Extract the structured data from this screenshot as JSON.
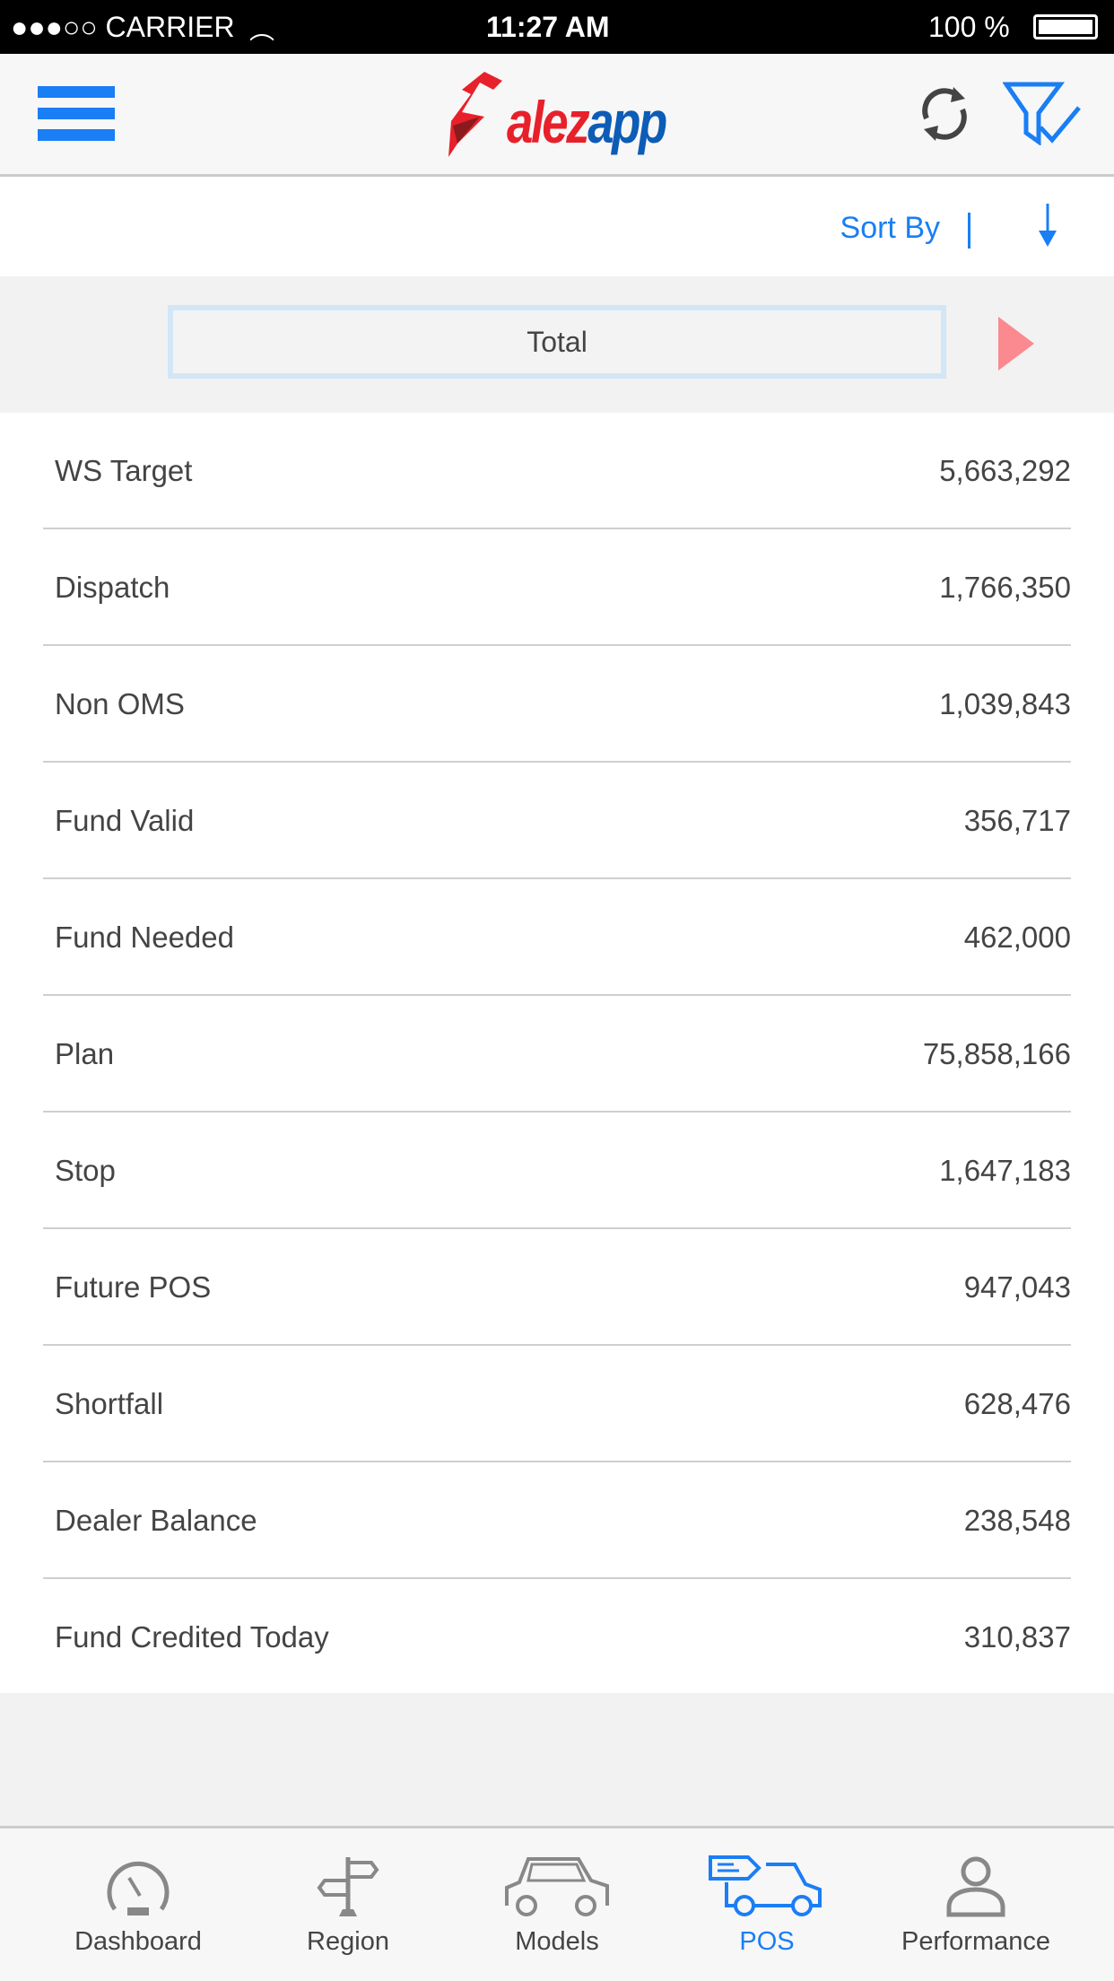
{
  "status_bar": {
    "carrier": "●●●○○ CARRIER",
    "time": "11:27 AM",
    "battery": "100 %"
  },
  "header": {
    "logo_text": "alezapp",
    "icons": [
      "menu-icon",
      "refresh-icon",
      "filter-check-icon"
    ]
  },
  "sort": {
    "label": "Sort By",
    "direction_icon": "arrow-down-icon"
  },
  "selector": {
    "value": "Total",
    "next_icon": "play-right-icon"
  },
  "rows": [
    {
      "label": "WS Target",
      "value": "5,663,292"
    },
    {
      "label": "Dispatch",
      "value": "1,766,350"
    },
    {
      "label": "Non OMS",
      "value": "1,039,843"
    },
    {
      "label": "Fund Valid",
      "value": "356,717"
    },
    {
      "label": "Fund Needed",
      "value": "462,000"
    },
    {
      "label": "Plan",
      "value": "75,858,166"
    },
    {
      "label": "Stop",
      "value": "1,647,183"
    },
    {
      "label": "Future POS",
      "value": "947,043"
    },
    {
      "label": "Shortfall",
      "value": "628,476"
    },
    {
      "label": "Dealer Balance",
      "value": "238,548"
    },
    {
      "label": "Fund Credited Today",
      "value": "310,837"
    }
  ],
  "tabs": [
    {
      "label": "Dashboard",
      "icon": "speedometer-icon"
    },
    {
      "label": "Region",
      "icon": "signpost-icon"
    },
    {
      "label": "Models",
      "icon": "car-icon"
    },
    {
      "label": "POS",
      "icon": "delivery-truck-icon",
      "active": true
    },
    {
      "label": "Performance",
      "icon": "user-icon"
    }
  ],
  "colors": {
    "accent": "#1a7ef5",
    "logo_red": "#e8202a",
    "logo_blue": "#0d5cb6",
    "next_arrow": "#fa8a8f"
  }
}
